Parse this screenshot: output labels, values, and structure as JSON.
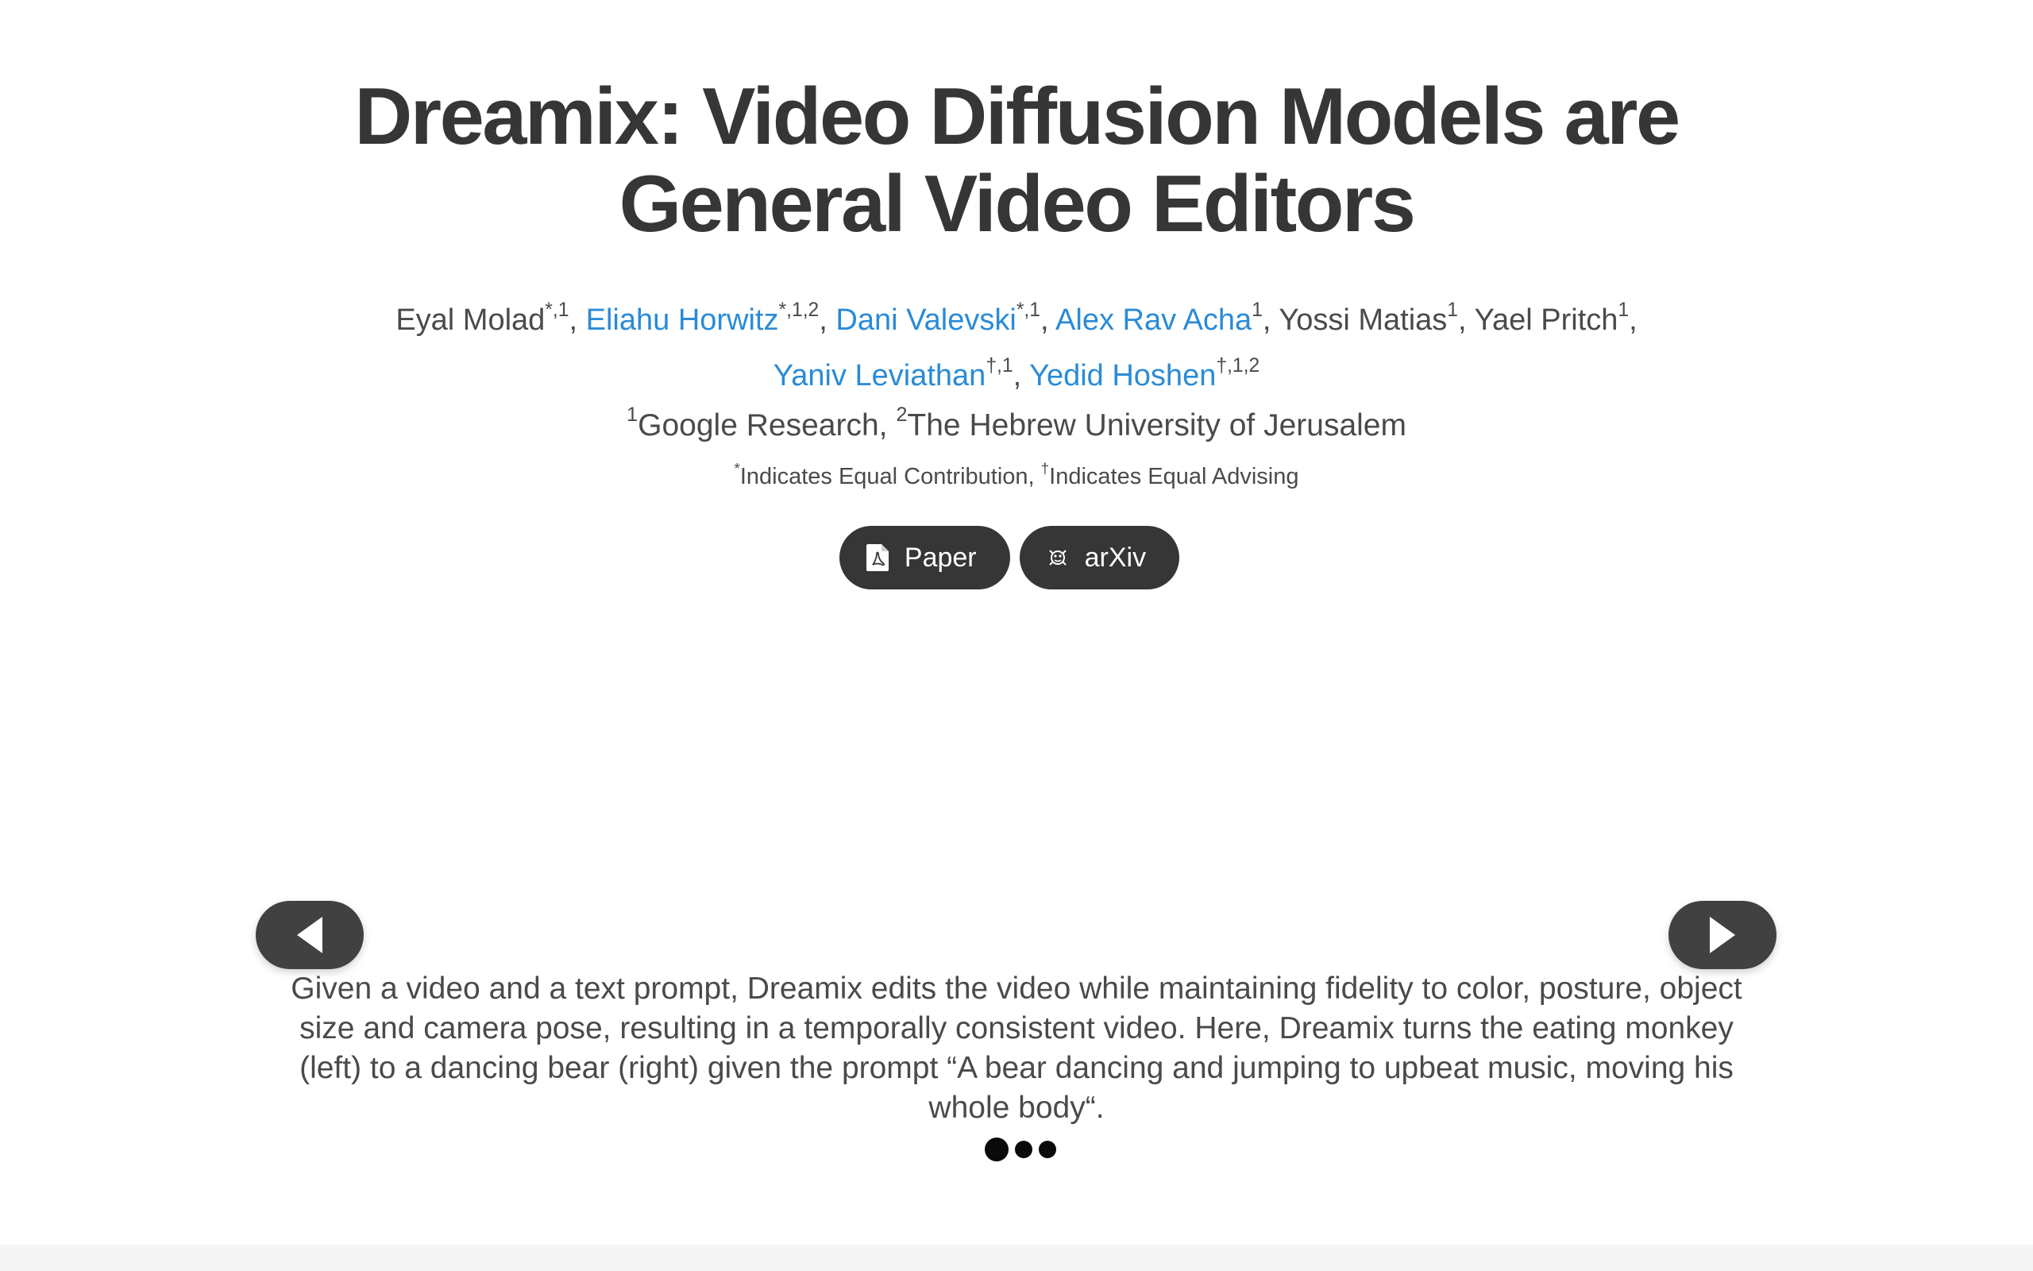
{
  "title": "Dreamix: Video Diffusion Models are General Video Editors",
  "authors": [
    {
      "name": "Eyal Molad",
      "sup": "*,1",
      "sep": ", ",
      "linked": false
    },
    {
      "name": "Eliahu Horwitz",
      "sup": "*,1,2",
      "sep": ", ",
      "linked": true
    },
    {
      "name": "Dani Valevski",
      "sup": "*,1",
      "sep": ", ",
      "linked": true
    },
    {
      "name": "Alex Rav Acha",
      "sup": "1",
      "sep": ", ",
      "linked": true
    },
    {
      "name": "Yossi Matias",
      "sup": "1",
      "sep": ", ",
      "linked": false
    },
    {
      "name": "Yael Pritch",
      "sup": "1",
      "sep": ",",
      "linked": false
    },
    {
      "name": "Yaniv Leviathan",
      "sup": "†,1",
      "sep": ", ",
      "linked": true
    },
    {
      "name": "Yedid Hoshen",
      "sup": "†,1,2",
      "sep": "",
      "linked": true
    }
  ],
  "affiliations": [
    {
      "sup": "1",
      "name": "Google Research",
      "sep": ", "
    },
    {
      "sup": "2",
      "name": "The Hebrew University of Jerusalem",
      "sep": ""
    }
  ],
  "contribution_note": {
    "equal_contribution_sup": "*",
    "equal_contribution": "Indicates Equal Contribution, ",
    "equal_advising_sup": "†",
    "equal_advising": "Indicates Equal Advising"
  },
  "buttons": {
    "paper": {
      "label": "Paper",
      "icon": "file-pdf-icon"
    },
    "arxiv": {
      "label": "arXiv",
      "icon": "arxiv-icon"
    }
  },
  "carousel": {
    "caption": "Given a video and a text prompt, Dreamix edits the video while maintaining fidelity to color, posture, object size and camera pose, resulting in a temporally consistent video. Here, Dreamix turns the eating monkey (left) to a dancing bear (right) given the prompt “A bear dancing and jumping to upbeat music, moving his whole body“.",
    "slide_count": 3,
    "active_slide": 1,
    "prev_icon": "caret-left-icon",
    "next_icon": "caret-right-icon"
  },
  "colors": {
    "text": "#363636",
    "link": "#2a8bd7",
    "button_bg": "#363636",
    "footer_bg": "#f5f5f5"
  }
}
